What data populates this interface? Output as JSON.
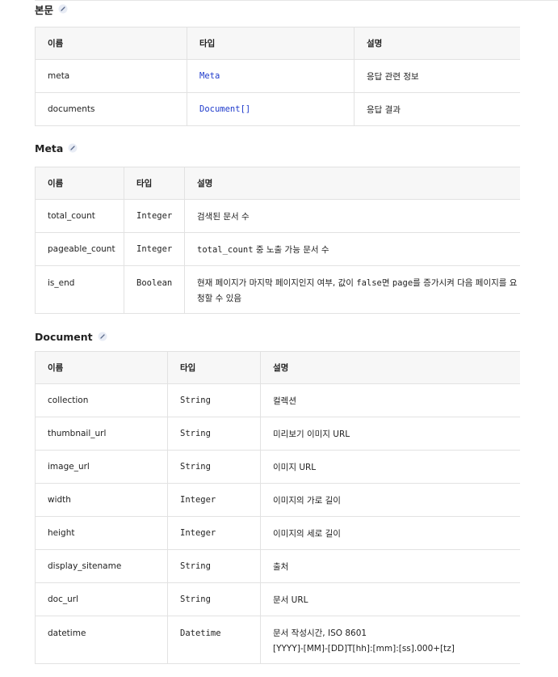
{
  "body_section": {
    "title": "본문",
    "headers": [
      "이름",
      "타입",
      "설명"
    ],
    "rows": [
      {
        "name": "meta",
        "type": "Meta",
        "desc": "응답 관련 정보"
      },
      {
        "name": "documents",
        "type": "Document[]",
        "desc": "응답 결과"
      }
    ]
  },
  "meta_section": {
    "title": "Meta",
    "headers": [
      "이름",
      "타입",
      "설명"
    ],
    "rows": [
      {
        "name": "total_count",
        "type": "Integer",
        "desc": "검색된 문서 수"
      },
      {
        "name": "pageable_count",
        "type": "Integer",
        "desc_code": "total_count",
        "desc": " 중 노출 가능 문서 수"
      },
      {
        "name": "is_end",
        "type": "Boolean",
        "desc_a": "현재 페이지가 마지막 페이지인지 여부, 값이 ",
        "desc_code1": "false",
        "desc_b": "면 ",
        "desc_code2": "page",
        "desc_c": "를 증가시켜 다음 페이지를 요청할 수 있음"
      }
    ]
  },
  "document_section": {
    "title": "Document",
    "headers": [
      "이름",
      "타입",
      "설명"
    ],
    "rows": [
      {
        "name": "collection",
        "type": "String",
        "desc": "컬렉션"
      },
      {
        "name": "thumbnail_url",
        "type": "String",
        "desc": "미리보기 이미지 URL"
      },
      {
        "name": "image_url",
        "type": "String",
        "desc": "이미지 URL"
      },
      {
        "name": "width",
        "type": "Integer",
        "desc": "이미지의 가로 길이"
      },
      {
        "name": "height",
        "type": "Integer",
        "desc": "이미지의 세로 길이"
      },
      {
        "name": "display_sitename",
        "type": "String",
        "desc": "출처"
      },
      {
        "name": "doc_url",
        "type": "String",
        "desc": "문서 URL"
      },
      {
        "name": "datetime",
        "type": "Datetime",
        "desc_line1": "문서 작성시간, ISO 8601",
        "desc_line2": "[YYYY]-[MM]-[DD]T[hh]:[mm]:[ss].000+[tz]"
      }
    ]
  },
  "icons": {
    "section_anchor": "link-icon"
  },
  "colors": {
    "link": "#1f3bcc",
    "header_bg": "#f7f7f7",
    "border": "#e2e2e2"
  }
}
